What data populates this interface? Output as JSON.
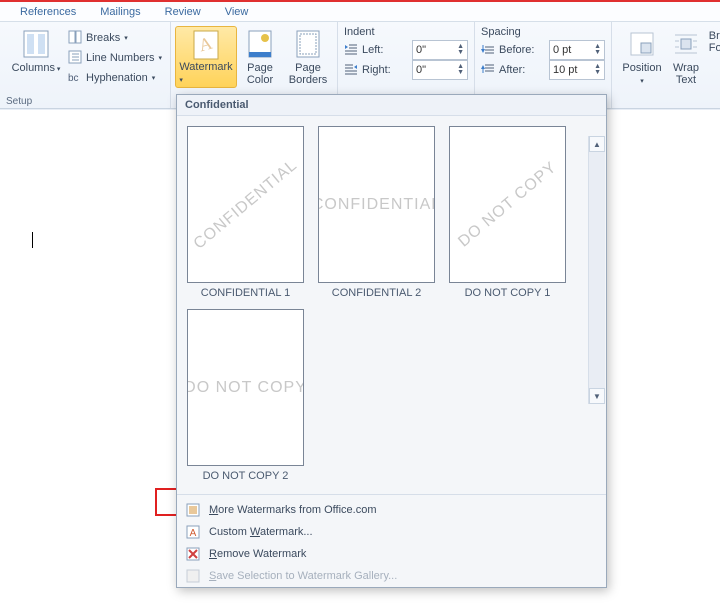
{
  "tabs": {
    "references": "References",
    "mailings": "Mailings",
    "review": "Review",
    "view": "View"
  },
  "ribbon": {
    "columns": "Columns",
    "breaks": "Breaks",
    "line_numbers": "Line Numbers",
    "hyphenation": "Hyphenation",
    "setup_label": "Setup",
    "watermark": "Watermark",
    "page_color": "Page\nColor",
    "page_borders": "Page\nBorders",
    "indent_title": "Indent",
    "left": "Left:",
    "right": "Right:",
    "left_val": "0\"",
    "right_val": "0\"",
    "spacing_title": "Spacing",
    "before": "Before:",
    "after": "After:",
    "before_val": "0 pt",
    "after_val": "10 pt",
    "position": "Position",
    "wrap_text": "Wrap\nText",
    "bring_fwd": "Br\nFor"
  },
  "dropdown": {
    "header": "Confidential",
    "previews": [
      {
        "text": "CONFIDENTIAL",
        "style": "diag",
        "label": "CONFIDENTIAL 1"
      },
      {
        "text": "CONFIDENTIAL",
        "style": "horiz",
        "label": "CONFIDENTIAL 2"
      },
      {
        "text": "DO NOT COPY",
        "style": "diag",
        "label": "DO NOT COPY 1"
      },
      {
        "text": "DO NOT COPY",
        "style": "horiz",
        "label": "DO NOT COPY 2"
      }
    ],
    "more": "More Watermarks from Office.com",
    "custom": "Custom Watermark...",
    "remove": "Remove Watermark",
    "save_sel": "Save Selection to Watermark Gallery..."
  }
}
